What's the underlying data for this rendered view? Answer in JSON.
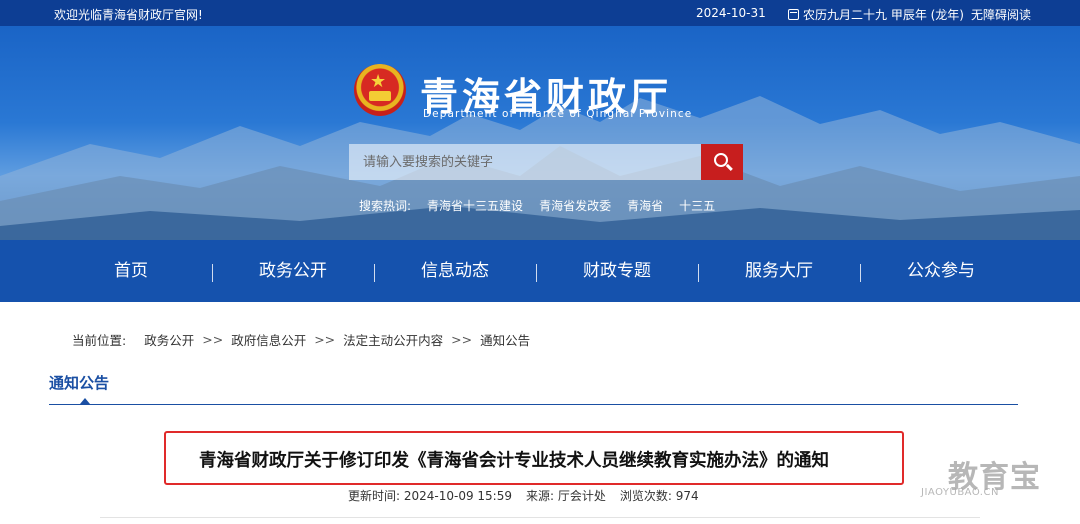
{
  "topbar": {
    "welcome": "欢迎光临青海省财政厅官网!",
    "date": "2024-10-31",
    "lunar": "农历九月二十九 甲辰年 (龙年)",
    "accessibility": "无障碍阅读"
  },
  "header": {
    "title": "青海省财政厅",
    "subtitle": "Department of finance of Qinghai Province",
    "search_placeholder": "请输入要搜索的关键字",
    "hot_label": "搜索热词:",
    "hot_words": [
      "青海省十三五建设",
      "青海省发改委",
      "青海省",
      "十三五"
    ]
  },
  "nav": {
    "items": [
      "首页",
      "政务公开",
      "信息动态",
      "财政专题",
      "服务大厅",
      "公众参与"
    ]
  },
  "breadcrumb": {
    "label": "当前位置:",
    "items": [
      "政务公开",
      "政府信息公开",
      "法定主动公开内容",
      "通知公告"
    ],
    "separator": ">>"
  },
  "section": {
    "title": "通知公告"
  },
  "article": {
    "title": "青海省财政厅关于修订印发《青海省会计专业技术人员继续教育实施办法》的通知",
    "updated": "更新时间: 2024-10-09 15:59",
    "source": "来源: 厅会计处",
    "views": "浏览次数: 974"
  },
  "watermark": {
    "brand": "教育宝",
    "domain": "JIAOYUBAO.CN"
  },
  "colors": {
    "topbar": "#0d3e94",
    "nav": "#1552ad",
    "accent": "#1a4fa3",
    "highlight_border": "#e02a2a",
    "search_button": "#c71e1e"
  }
}
